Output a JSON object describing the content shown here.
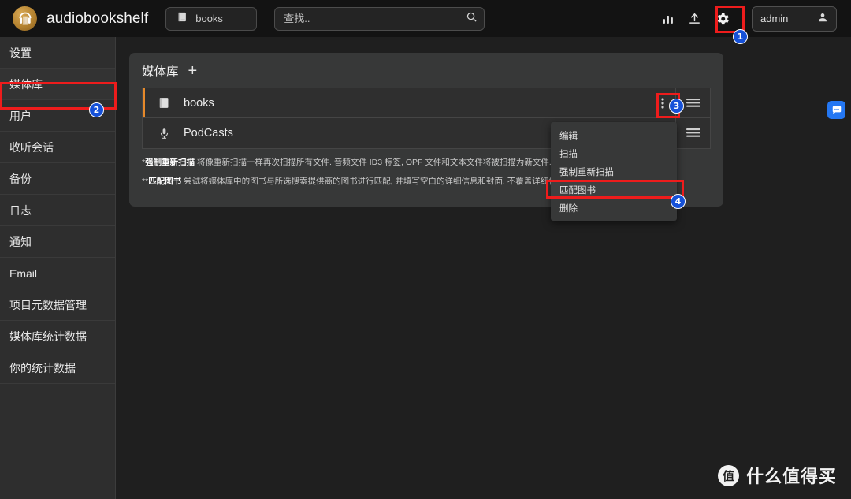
{
  "header": {
    "brand": "audiobookshelf",
    "logo_icon": "audiobookshelf-logo-icon",
    "library_selector": {
      "label": "books",
      "icon": "book-icon"
    },
    "search": {
      "placeholder": "查找..",
      "value": "",
      "icon": "search-icon"
    },
    "icons": [
      {
        "name": "stats-bar-chart-icon",
        "glyph": "chart"
      },
      {
        "name": "upload-icon",
        "glyph": "upload"
      },
      {
        "name": "settings-gear-icon",
        "glyph": "gear"
      }
    ],
    "user": {
      "label": "admin",
      "icon": "user-avatar-icon"
    }
  },
  "sidebar": {
    "items": [
      {
        "label": "设置",
        "name": "sidebar-item-settings",
        "active": false
      },
      {
        "label": "媒体库",
        "name": "sidebar-item-libraries",
        "active": true
      },
      {
        "label": "用户",
        "name": "sidebar-item-users",
        "active": false
      },
      {
        "label": "收听会话",
        "name": "sidebar-item-listening-sessions",
        "active": false
      },
      {
        "label": "备份",
        "name": "sidebar-item-backups",
        "active": false
      },
      {
        "label": "日志",
        "name": "sidebar-item-logs",
        "active": false
      },
      {
        "label": "通知",
        "name": "sidebar-item-notifications",
        "active": false
      },
      {
        "label": "Email",
        "name": "sidebar-item-email",
        "active": false
      },
      {
        "label": "项目元数据管理",
        "name": "sidebar-item-item-metadata-utils",
        "active": false
      },
      {
        "label": "媒体库统计数据",
        "name": "sidebar-item-library-stats",
        "active": false
      },
      {
        "label": "你的统计数据",
        "name": "sidebar-item-your-stats",
        "active": false
      }
    ]
  },
  "panel": {
    "title": "媒体库",
    "add_label": "+",
    "libraries": [
      {
        "name": "books",
        "icon": "book-icon",
        "active": true
      },
      {
        "name": "PodCasts",
        "icon": "microphone-icon",
        "active": false
      }
    ],
    "footnotes": [
      {
        "marker": "*",
        "bold": "强制重新扫描",
        "text": " 将像重新扫描一样再次扫描所有文件. 音频文件 ID3 标签, OPF 文件和文本文件将被扫描为新文件."
      },
      {
        "marker": "**",
        "bold": "匹配图书",
        "text": " 尝试将媒体库中的图书与所选搜索提供商的图书进行匹配, 并填写空白的详细信息和封面. 不覆盖详细信息."
      }
    ]
  },
  "dropdown": {
    "items": [
      {
        "label": "编辑",
        "name": "menu-item-edit",
        "selected": false
      },
      {
        "label": "扫描",
        "name": "menu-item-scan",
        "selected": false
      },
      {
        "label": "强制重新扫描",
        "name": "menu-item-force-rescan",
        "selected": false
      },
      {
        "label": "匹配图书",
        "name": "menu-item-match-books",
        "selected": true
      },
      {
        "label": "删除",
        "name": "menu-item-delete",
        "selected": false
      }
    ]
  },
  "annotations": {
    "badges": [
      {
        "number": "1",
        "target": "settings-gear-icon"
      },
      {
        "number": "2",
        "target": "sidebar-item-libraries"
      },
      {
        "number": "3",
        "target": "library-row-overflow-menu"
      },
      {
        "number": "4",
        "target": "menu-item-match-books"
      }
    ],
    "highlight_color": "#ee1c1c",
    "badge_color": "#1651d8"
  },
  "chat_widget": {
    "icon": "chat-bubble-icon"
  },
  "watermark": {
    "logo_text": "值",
    "text": "什么值得买"
  }
}
